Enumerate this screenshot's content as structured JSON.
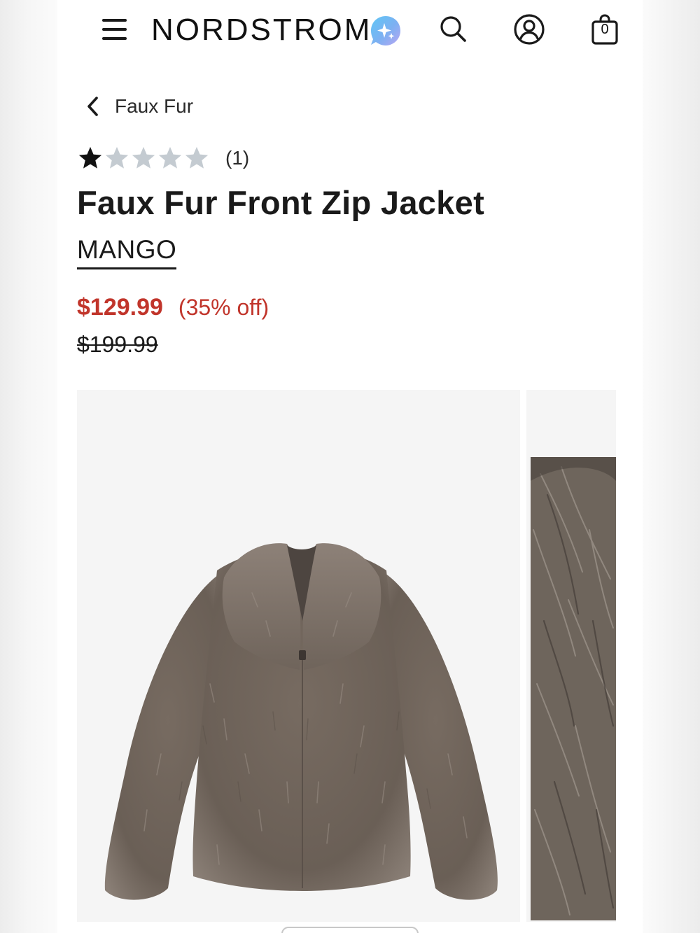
{
  "header": {
    "logo": "NORDSTROM",
    "icons": [
      "menu-icon",
      "sparkle-ai-icon",
      "search-icon",
      "account-icon",
      "bag-icon"
    ],
    "bag_count": "0"
  },
  "breadcrumb": {
    "label": "Faux Fur"
  },
  "rating": {
    "stars_filled": 1,
    "stars_total": 5,
    "count": "(1)"
  },
  "product": {
    "title": "Faux Fur Front Zip Jacket",
    "brand": "MANGO",
    "sale_price": "$129.99",
    "discount": "(35% off)",
    "original_price": "$199.99"
  },
  "colors": {
    "sale": "#c1352b",
    "star_filled": "#111111",
    "star_empty": "#c4cbd1",
    "fur": "#7a6e64"
  }
}
